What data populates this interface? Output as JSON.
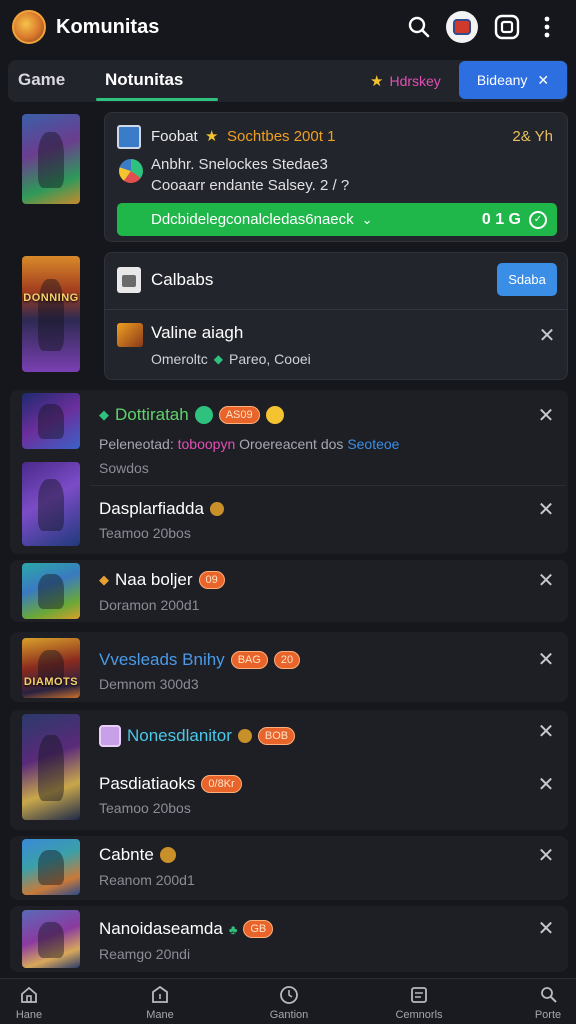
{
  "header": {
    "title": "Komunitas",
    "search_icon": "search-icon",
    "settings_icon": "square-settings-icon",
    "more_icon": "more-vertical-icon"
  },
  "tabs": {
    "game": "Game",
    "komunitas": "Notunitas",
    "hotkey_label": "Hdrskey",
    "action_button": "Bideany",
    "accent": "#2ec27e"
  },
  "card1": {
    "title": "Foobat",
    "subtitle": "Sochtbes 200t 1",
    "meta": "2& Yh",
    "line1": "Anbhr. Snelockes Stedae3",
    "line2": "Cooaarr endante Salsey. 2 / ?",
    "bar_label": "Ddcbidelegconalcledas6naeck",
    "bar_count": "0 1 G",
    "bar_color": "#1fb64a"
  },
  "card2": {
    "title": "Calbabs",
    "button": "Sdaba",
    "sub_title": "Valine aiagh",
    "sub_meta_left": "Omeroltc",
    "sub_meta_right": "Pareo, Cooei"
  },
  "feed": [
    {
      "title": "Dottiratah",
      "badge": "AS09",
      "sub_a": "Peleneotad:",
      "sub_b": "toboopyn",
      "sub_c": "Oroereacent dos",
      "sub_d": "Seoteoe",
      "sub_e": "Sowdos"
    },
    {
      "title": "Dasplarfiadda",
      "sub": "Teamoo 20bos"
    },
    {
      "title": "Naa boljer",
      "badge": "09",
      "sub": "Doramon 200d1"
    },
    {
      "title": "Vvesleads Bnihy",
      "badge": "BAG",
      "badge2": "20",
      "sub": "Demnom 300d3"
    },
    {
      "title": "Nonesdlanitor",
      "badge": "BOB",
      "title2": "Pasdiatiaoks",
      "badge3": "0/8Kr"
    },
    {
      "title": "Cabnte",
      "sub": "Reanom 200d1"
    },
    {
      "title": "Nanoidaseamda",
      "badge": "GB",
      "sub": "Reamgo 20ndi"
    }
  ],
  "nav": [
    {
      "label": "Hane",
      "icon": "home-icon"
    },
    {
      "label": "Mane",
      "icon": "store-icon"
    },
    {
      "label": "Gantion",
      "icon": "clock-icon"
    },
    {
      "label": "Cemnorls",
      "icon": "chat-icon"
    },
    {
      "label": "Porte",
      "icon": "profile-search-icon"
    }
  ],
  "thumbs": {
    "t2_banner": "DONNING",
    "t6_banner": "DIAMOTS"
  }
}
